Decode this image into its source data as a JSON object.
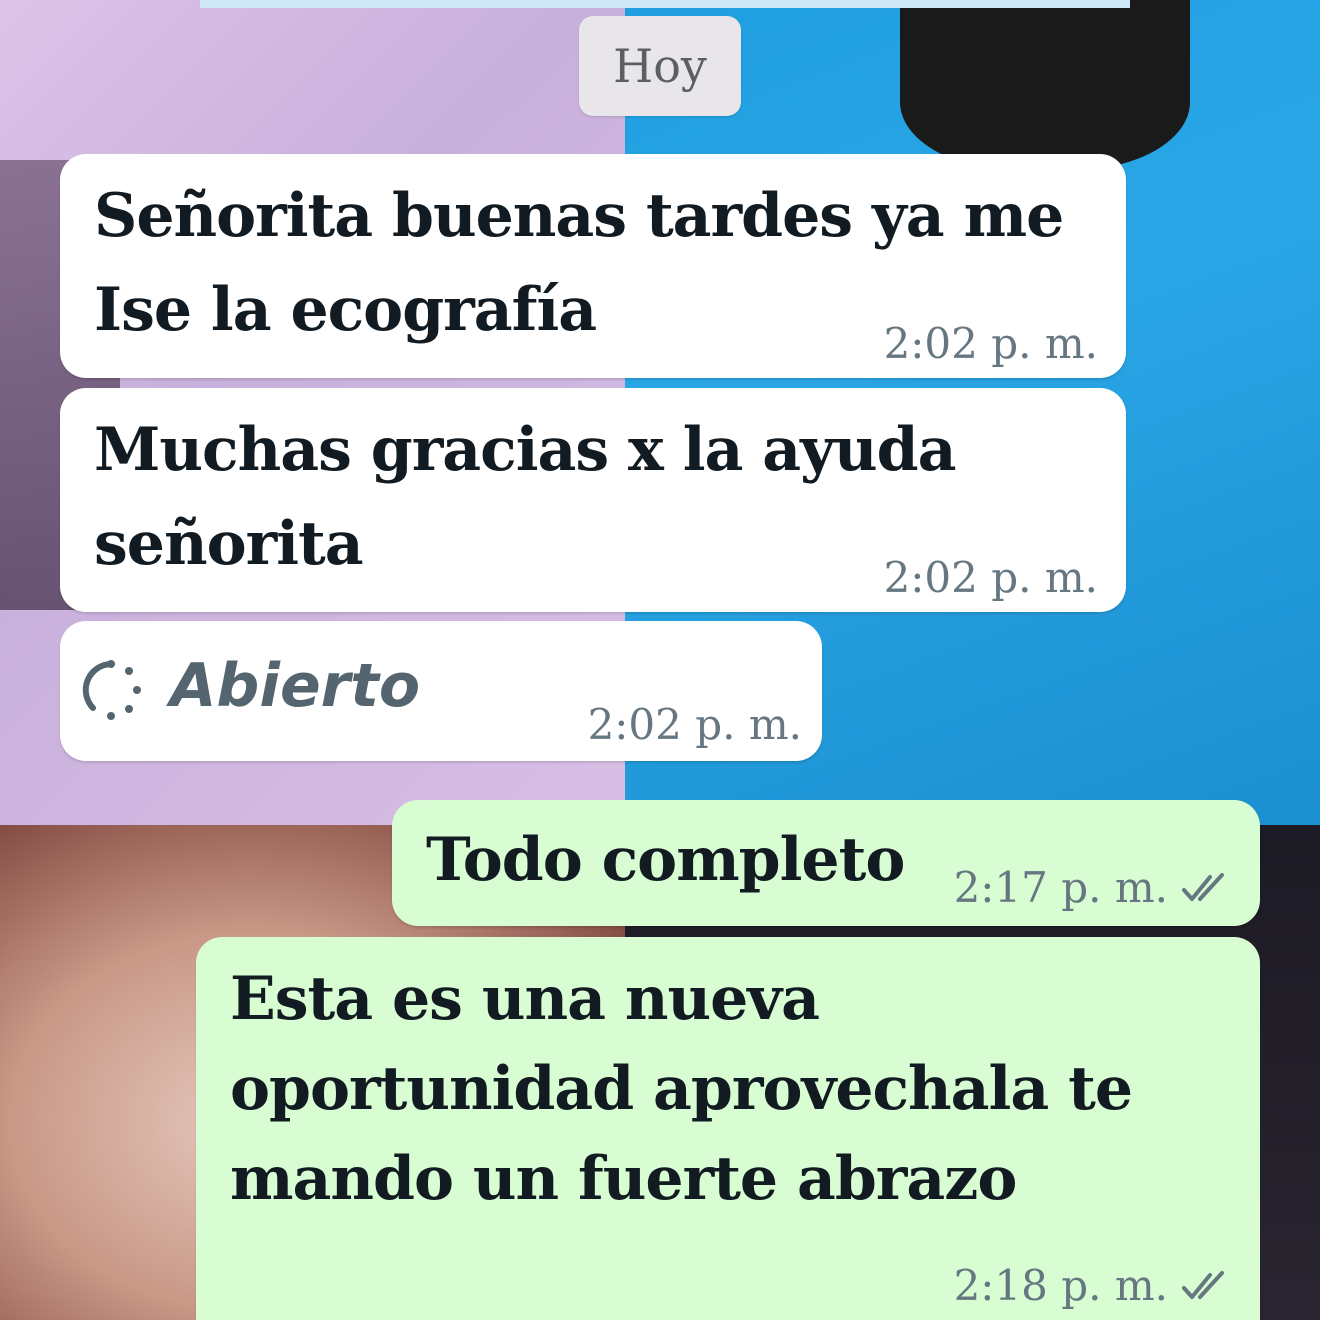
{
  "chat": {
    "date_chip": "Hoy",
    "messages": [
      {
        "direction": "incoming",
        "lines": [
          "Señorita buenas tardes ya me",
          "Ise la ecografía"
        ],
        "time": "2:02 p. m."
      },
      {
        "direction": "incoming",
        "lines": [
          "Muchas gracias x la ayuda",
          "señorita"
        ],
        "time": "2:02 p. m."
      },
      {
        "direction": "incoming",
        "type": "status",
        "icon": "loading-circle-icon",
        "text": "Abierto",
        "time": "2:02 p. m."
      },
      {
        "direction": "outgoing",
        "lines": [
          "Todo completo"
        ],
        "time": "2:17 p. m.",
        "receipt_icon": "double-check-icon"
      },
      {
        "direction": "outgoing",
        "lines": [
          "Esta es una nueva",
          "oportunidad aprovechala te",
          "mando un fuerte abrazo"
        ],
        "time": "2:18 p. m.",
        "receipt_icon": "double-check-icon"
      }
    ]
  },
  "colors": {
    "incoming_bubble": "#ffffff",
    "outgoing_bubble": "#d9fdd3",
    "message_text": "#111b21",
    "meta_text": "#667781"
  }
}
